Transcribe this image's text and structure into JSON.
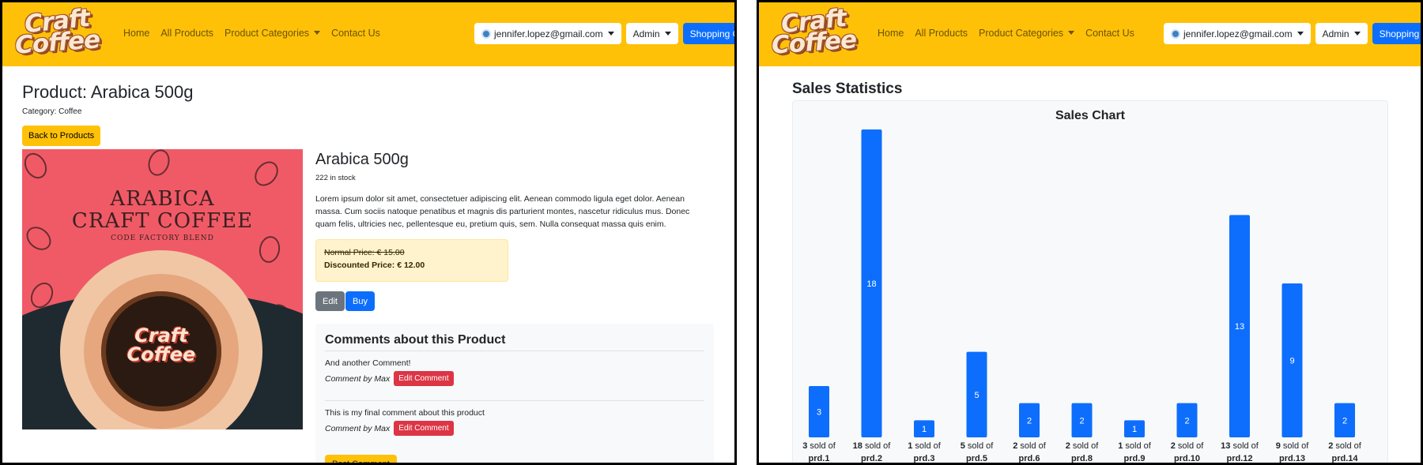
{
  "brand": {
    "line1": "Craft",
    "line2": "Coffee"
  },
  "nav": {
    "home": "Home",
    "all_products": "All Products",
    "product_categories": "Product Categories",
    "contact": "Contact Us",
    "user_email": "jennifer.lopez@gmail.com",
    "admin": "Admin",
    "cart": "Shopping Cart"
  },
  "product_page": {
    "title": "Product: Arabica 500g",
    "category": "Category: Coffee",
    "back_button": "Back to Products",
    "image": {
      "title_line1": "ARABICA",
      "title_line2": "CRAFT COFFEE",
      "subtitle": "CODE FACTORY BLEND",
      "cup_logo_line1": "Craft",
      "cup_logo_line2": "Coffee"
    },
    "name": "Arabica 500g",
    "stock": "222 in stock",
    "description": "Lorem ipsum dolor sit amet, consectetuer adipiscing elit. Aenean commodo ligula eget dolor. Aenean massa. Cum sociis natoque penatibus et magnis dis parturient montes, nascetur ridiculus mus. Donec quam felis, ultricies nec, pellentesque eu, pretium quis, sem. Nulla consequat massa quis enim.",
    "normal_price": "Normal Price: € 15.00",
    "discounted_price": "Discounted Price: € 12.00",
    "edit_button": "Edit",
    "buy_button": "Buy",
    "comments_title": "Comments about this Product",
    "comments": [
      {
        "text": "And another Comment!",
        "author": "Comment by Max",
        "edit_label": "Edit Comment"
      },
      {
        "text": "This is my final comment about this product",
        "author": "Comment by Max",
        "edit_label": "Edit Comment"
      }
    ],
    "post_comment": "Post Comment"
  },
  "stats_page": {
    "title": "Sales Statistics"
  },
  "colors": {
    "navbar": "#ffc107",
    "primary": "#0d6efd",
    "danger": "#dc3545",
    "secondary": "#6c757d"
  },
  "chart_data": {
    "type": "bar",
    "title": "Sales Chart",
    "categories": [
      "prd.1",
      "prd.2",
      "prd.3",
      "prd.5",
      "prd.6",
      "prd.8",
      "prd.9",
      "prd.10",
      "prd.12",
      "prd.13",
      "prd.14"
    ],
    "values": [
      3,
      18,
      1,
      5,
      2,
      2,
      1,
      2,
      13,
      9,
      2
    ],
    "label_suffix": "sold of",
    "bar_color": "#0d6efd",
    "grid": false,
    "legend": "none"
  }
}
